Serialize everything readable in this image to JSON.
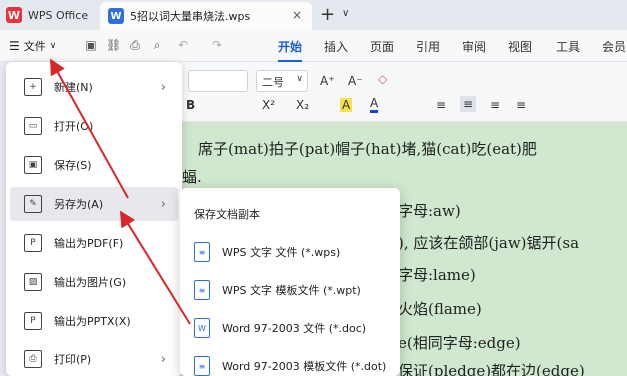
{
  "titlebar": {
    "app_tab": "WPS Office",
    "doc_tab": "5招以词大量串烧法.wps",
    "close_glyph": "×",
    "new_tab_glyph": "+",
    "tab_menu_glyph": "∨"
  },
  "toolbar": {
    "file_label": "文件",
    "hamburger": "☰",
    "caret": "∨",
    "tabs": [
      "开始",
      "插入",
      "页面",
      "引用",
      "审阅",
      "视图",
      "工具",
      "会员"
    ]
  },
  "ribbon": {
    "size_value": "二号",
    "size_caret": "∨",
    "grow_font": "A⁺",
    "shrink_font": "A⁻",
    "clear_format": "◇",
    "bold": "B",
    "superscript": "X²",
    "subscript": "X₂",
    "highlight": "A",
    "font_color": "A",
    "align_left": "≡",
    "align_center": "≡",
    "align_right": "≡",
    "justify": "≡"
  },
  "document": {
    "lines": [
      "席子(mat)拍子(pat)帽子(hat)堵,猫(cat)吃(eat)肥",
      "蝠.",
      "字母:aw)",
      "), 应该在颌部(jaw)锯开(sa",
      "字母:lame)",
      "火焰(flame)",
      "e(相同字母:edge)",
      "保证(pledge)都在边(edge)"
    ]
  },
  "filemenu": {
    "items": [
      {
        "label": "新建(N)",
        "icon": "+",
        "arrow": "›"
      },
      {
        "label": "打开(O)",
        "icon": "▭",
        "arrow": ""
      },
      {
        "label": "保存(S)",
        "icon": "▣",
        "arrow": ""
      },
      {
        "label": "另存为(A)",
        "icon": "✎",
        "arrow": "›"
      },
      {
        "label": "输出为PDF(F)",
        "icon": "P",
        "arrow": ""
      },
      {
        "label": "输出为图片(G)",
        "icon": "▨",
        "arrow": ""
      },
      {
        "label": "输出为PPTX(X)",
        "icon": "P",
        "arrow": ""
      },
      {
        "label": "打印(P)",
        "icon": "⎙",
        "arrow": "›"
      }
    ]
  },
  "submenu": {
    "title": "保存文档副本",
    "items": [
      {
        "label": "WPS 文字 文件 (*.wps)",
        "icon": "≡"
      },
      {
        "label": "WPS 文字 模板文件 (*.wpt)",
        "icon": "≡"
      },
      {
        "label": "Word 97-2003 文件 (*.doc)",
        "icon": "W"
      },
      {
        "label": "Word 97-2003 模板文件 (*.dot)",
        "icon": "≡"
      }
    ]
  },
  "colors": {
    "accent": "#1a5fd8",
    "arrow_red": "#d8262b",
    "doc_bg": "#cfe8cf"
  }
}
